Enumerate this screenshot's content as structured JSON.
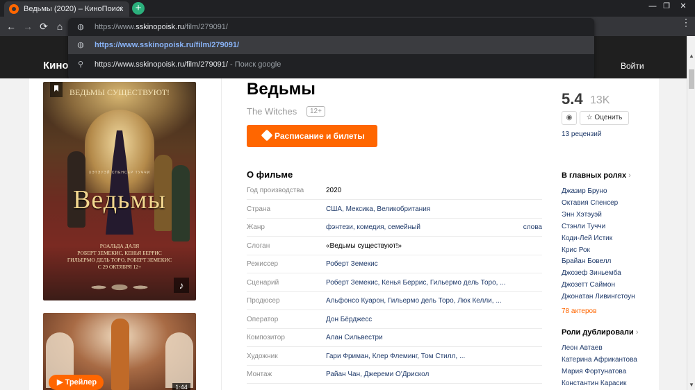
{
  "browser": {
    "tab_title": "Ведьмы (2020) – КиноПоиск",
    "tab_close": "×",
    "new_tab": "+",
    "win_min": "—",
    "win_max": "❐",
    "win_close": "✕",
    "back": "←",
    "forward": "→",
    "reload": "⟳",
    "home": "⌂",
    "menu": "⋮"
  },
  "omnibox": {
    "input_host_prefix": "https://www.",
    "input_host": "sskinopoisk.ru",
    "input_path": "/film/279091/",
    "suggestion_url": "https://www.sskinopoisk.ru/film/279091/",
    "search_query": "https://www.sskinopoisk.ru/film/279091/",
    "search_suffix": " - Поиск google"
  },
  "site": {
    "logo": "Кино",
    "login": "Войти"
  },
  "poster": {
    "tagline": "ВЕДЬМЫ СУЩЕСТВУЮТ!",
    "names": "ХЭТЭУЭЙ   СПЕНСЕР   ТУЧЧИ",
    "title": "Ведьмы",
    "credits_1": "РОАЛЬДА ДАЛЯ",
    "credits_2": "РОБЕРТ ЗЕМЕКИС, КЕНЬЯ БЕРРИС",
    "credits_3": "ГИЛЬЕРМО ДЕЛЬ ТОРО, РОБЕРТ ЗЕМЕКИС",
    "credits_4": "С 29 ОКТЯБРЯ   12+",
    "music_icon": "♪"
  },
  "trailer": {
    "button": "▶ Трейлер",
    "duration": "1:44"
  },
  "movie": {
    "title": "Ведьмы",
    "original_title": "The Witches",
    "age": "12+",
    "tickets_button": "Расписание и билеты"
  },
  "about": {
    "title": "О фильме",
    "rows": [
      {
        "label": "Год производства",
        "value": "2020",
        "extra": ""
      },
      {
        "label": "Страна",
        "value": "США, Мексика, Великобритания",
        "extra": ""
      },
      {
        "label": "Жанр",
        "value": "фэнтези, комедия, семейный",
        "extra": "слова"
      },
      {
        "label": "Слоган",
        "value": "«Ведьмы существуют!»",
        "extra": ""
      },
      {
        "label": "Режиссер",
        "value": "Роберт Земекис",
        "extra": ""
      },
      {
        "label": "Сценарий",
        "value": "Роберт Земекис, Кенья Беррис, Гильермо дель Торо, ...",
        "extra": ""
      },
      {
        "label": "Продюсер",
        "value": "Альфонсо Куарон, Гильермо дель Торо, Люк Келли, ...",
        "extra": ""
      },
      {
        "label": "Оператор",
        "value": "Дон Бёрджесс",
        "extra": ""
      },
      {
        "label": "Композитор",
        "value": "Алан Сильвестри",
        "extra": ""
      },
      {
        "label": "Художник",
        "value": "Гари Фриман, Клер Флеминг, Том Стилл, ...",
        "extra": ""
      },
      {
        "label": "Монтаж",
        "value": "Райан Чан, Джереми О'Дрискол",
        "extra": ""
      }
    ]
  },
  "rating": {
    "value": "5.4",
    "count": "13K",
    "rate_button": "☆ Оценить",
    "eye_icon": "◉",
    "reviews": "13 рецензий"
  },
  "cast": {
    "title": "В главных ролях",
    "chevron": "›",
    "actors": [
      "Джазир Бруно",
      "Октавия Спенсер",
      "Энн Хэтэуэй",
      "Стэнли Туччи",
      "Коди-Лей Истик",
      "Крис Рок",
      "Брайан Бовелл",
      "Джозеф Зиньемба",
      "Джозетт Саймон",
      "Джонатан Ливингстоун"
    ],
    "more": "78 актеров"
  },
  "dubbing": {
    "title": "Роли дублировали",
    "chevron": "›",
    "actors": [
      "Леон Автаев",
      "Катерина Африкантова",
      "Мария Фортунатова",
      "Константин Карасик"
    ]
  },
  "scrollbar": {
    "up": "▲",
    "down": "▼"
  },
  "colors": {
    "accent": "#ff6600",
    "header_bg": "#1f1f1f",
    "link": "#1f3a6a"
  }
}
